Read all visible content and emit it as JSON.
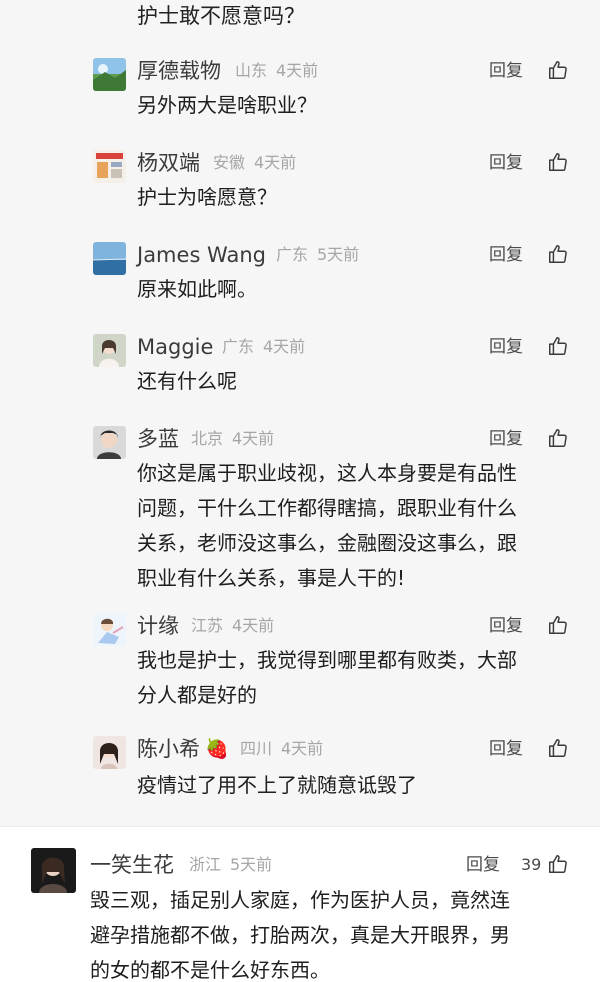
{
  "top_fragment": "护士敢不愿意吗？",
  "replies": [
    {
      "name": "厚德载物",
      "location": "山东",
      "time": "4天前",
      "reply": "回复",
      "text": "另外两大是啥职业？"
    },
    {
      "name": "杨双端",
      "location": "安徽",
      "time": "4天前",
      "reply": "回复",
      "text": "护士为啥愿意？"
    },
    {
      "name": "James Wang",
      "location": "广东",
      "time": "5天前",
      "reply": "回复",
      "text": "原来如此啊。"
    },
    {
      "name": "Maggie",
      "location": "广东",
      "time": "4天前",
      "reply": "回复",
      "text": "还有什么呢"
    },
    {
      "name": "多蓝",
      "location": "北京",
      "time": "4天前",
      "reply": "回复",
      "lines": [
        "你这是属于职业歧视，这人本身要是有品性",
        "问题，干什么工作都得瞎搞，跟职业有什么",
        "关系，老师没这事么，金融圈没这事么，跟",
        "职业有什么关系，事是人干的!"
      ]
    },
    {
      "name": "计缘",
      "location": "江苏",
      "time": "4天前",
      "reply": "回复",
      "lines": [
        "我也是护士，我觉得到哪里都有败类，大部",
        "分人都是好的"
      ]
    },
    {
      "name": "陈小希",
      "emoji": "🍓",
      "location": "四川",
      "time": "4天前",
      "reply": "回复",
      "text": "疫情过了用不上了就随意诋毁了"
    }
  ],
  "main_comment": {
    "name": "一笑生花",
    "location": "浙江",
    "time": "5天前",
    "reply": "回复",
    "likes": "39",
    "lines": [
      "毁三观，插足别人家庭，作为医护人员，竟然连",
      "避孕措施都不做，打胎两次，真是大开眼界，男",
      "的女的都不是什么好东西。"
    ]
  },
  "icons": {
    "like": "thumbs-up-icon"
  }
}
